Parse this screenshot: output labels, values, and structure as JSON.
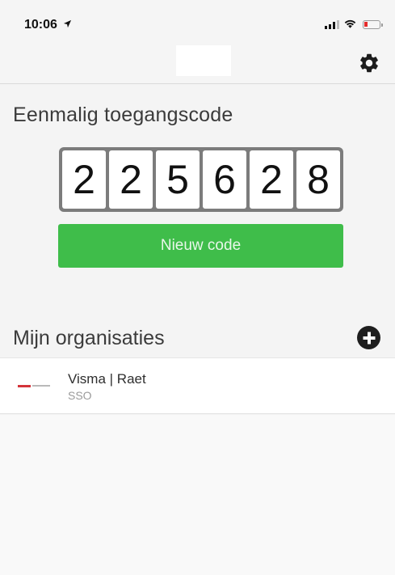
{
  "status_bar": {
    "time": "10:06",
    "icons": [
      "location-arrow-icon",
      "signal-bars-icon",
      "wifi-icon",
      "battery-low-icon"
    ],
    "battery_color": "#e52b2b"
  },
  "navbar": {
    "settings_icon": "gear-icon"
  },
  "otp": {
    "title": "Eenmalig toegangscode",
    "digits": [
      "2",
      "2",
      "5",
      "6",
      "2",
      "8"
    ],
    "button_label": "Nieuw code",
    "button_color": "#3fbd4a"
  },
  "organisations": {
    "title": "Mijn organisaties",
    "add_icon": "plus-circle-icon",
    "items": [
      {
        "name": "Visma | Raet",
        "subtitle": "SSO",
        "logo": "visma-raet-logo"
      }
    ]
  }
}
